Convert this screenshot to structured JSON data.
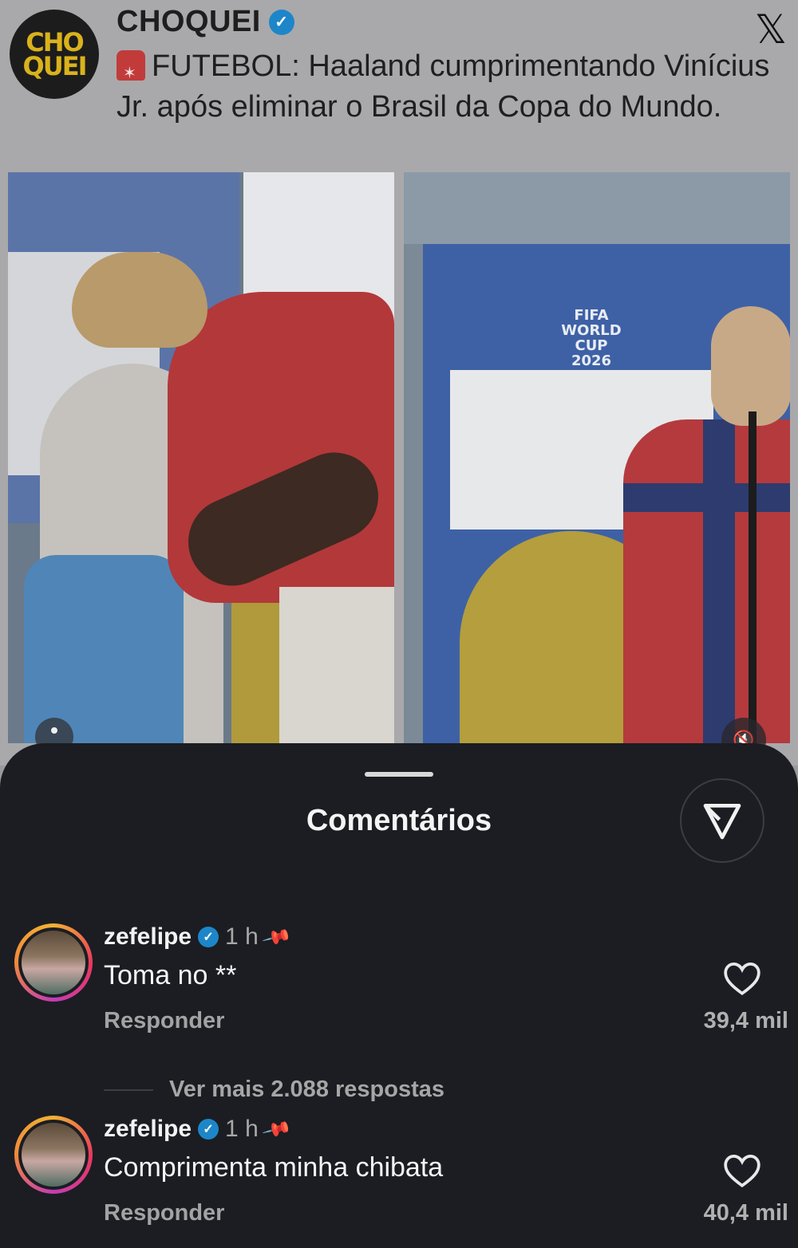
{
  "tweet": {
    "avatar_line1": "CHO",
    "avatar_line2": "QUEI",
    "handle": "CHOQUEI",
    "text": "FUTEBOL: Haaland cumprimentando Vinícius Jr. após eliminar o Brasil da Copa do Mundo.",
    "platform_logo": "𝕏",
    "photo_right_board_line1": "FIFA",
    "photo_right_board_line2": "WORLD CUP",
    "photo_right_board_line3": "2026",
    "icons": [
      "siren-icon",
      "verified-icon",
      "x-logo-icon",
      "mute-icon"
    ]
  },
  "sheet": {
    "title": "Comentários"
  },
  "comments": [
    {
      "user": "zefelipe",
      "time": "1 h",
      "text": "Toma no **",
      "reply_label": "Responder",
      "likes": "39,4 mil",
      "more_replies": "Ver mais 2.088 respostas"
    },
    {
      "user": "zefelipe",
      "time": "1 h",
      "text": "Comprimenta minha chibata",
      "reply_label": "Responder",
      "likes": "40,4 mil"
    }
  ],
  "colors": {
    "sheet_bg": "#1b1d22",
    "verified": "#1d86c9",
    "brand_yellow": "#d9b21c"
  }
}
